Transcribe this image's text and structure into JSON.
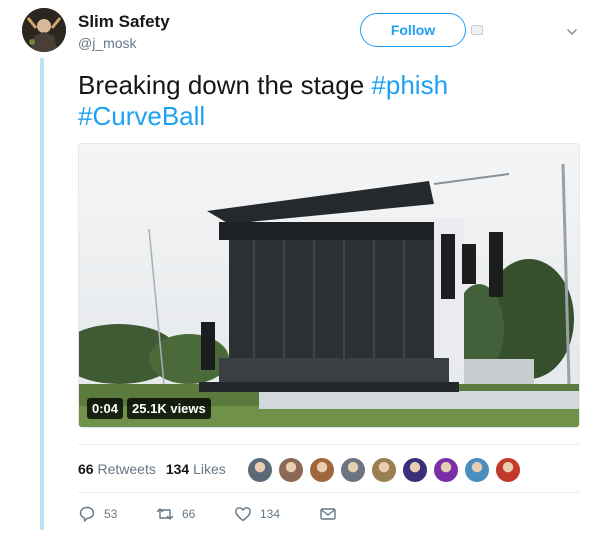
{
  "tweet": {
    "display_name": "Slim Safety",
    "username": "@j_mosk",
    "follow_label": "Follow",
    "text_plain": "Breaking down the stage ",
    "hashtag_1": "#phish",
    "hashtag_2": "#CurveBall",
    "video": {
      "duration": "0:04",
      "views": "25.1K views"
    },
    "retweets_count": "66",
    "retweets_label": "Retweets",
    "likes_count": "134",
    "likes_label": "Likes",
    "actions": {
      "reply_count": "53",
      "retweet_count": "66",
      "like_count": "134"
    },
    "liker_avatar_colors": [
      "#5b6a78",
      "#8a6a55",
      "#a0673e",
      "#6c7480",
      "#9a7f52",
      "#3b2f7a",
      "#7a2fa8",
      "#4a8fbf",
      "#c23a2a"
    ],
    "accent_color": "#1da1f2",
    "thread_line_color": "#bfe3f5"
  }
}
